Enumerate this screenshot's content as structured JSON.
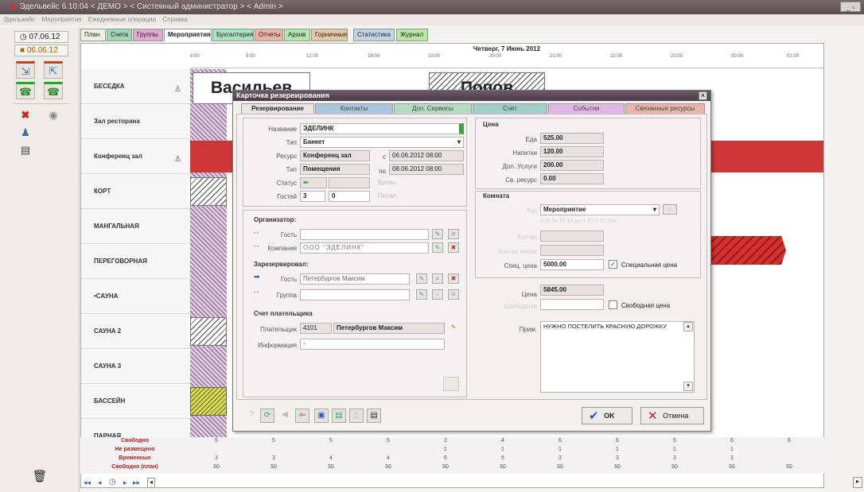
{
  "window": {
    "title": "Эдельвейс 6.10.04 < ДЕМО > < Системный администратор > < Admin >"
  },
  "menu": [
    "Эдельвейс",
    "Мероприятия",
    "Ежедневные операции",
    "Справка"
  ],
  "left": {
    "date1": "07.06.12",
    "date2": "06.06.12"
  },
  "tabs": [
    {
      "label": "План",
      "color": "#f1efe8"
    },
    {
      "label": "Счета",
      "color": "#9fd6b6"
    },
    {
      "label": "Группы",
      "color": "#e4a8d2"
    },
    {
      "label": "Мероприятия",
      "color": "#ffffff"
    },
    {
      "label": "Бухгалтерия",
      "color": "#a9e2c5"
    },
    {
      "label": "Отчеты",
      "color": "#f0b2a6"
    },
    {
      "label": "Архив",
      "color": "#b4e6b0"
    },
    {
      "label": "Горничные",
      "color": "#e6c6a4"
    },
    {
      "label": "Статистика",
      "color": "#c4d4e8"
    },
    {
      "label": "Журнал",
      "color": "#bde6a4"
    }
  ],
  "schedule": {
    "date_title": "Четверг, 7 Июнь 2012",
    "times": [
      "8:00",
      "9:00",
      "12:00",
      "18:00",
      "19:00",
      "20:00",
      "21:00",
      "22:00",
      "23:00",
      "00:00",
      "01:00"
    ],
    "rows": [
      "БЕСЕДКА",
      "Зал ресторана",
      "Конференц зал",
      "КОРТ",
      "МАНГАЛЬНАЯ",
      "ПЕРЕГОВОРНАЯ",
      "•САУНА",
      "САУНА 2",
      "САУНА 3",
      "БАССЕЙН",
      "ПАРНАЯ"
    ],
    "event_vasiliev": "Васильев",
    "event_popov": "Попов"
  },
  "summary": {
    "labels": [
      "Свободно",
      "Не размещено",
      "Временные",
      "Свободно (план)"
    ],
    "rows": [
      [
        "5",
        "5",
        "5",
        "5",
        "2",
        "4",
        "6",
        "6",
        "5",
        "6",
        "6"
      ],
      [
        "",
        "",
        "",
        "",
        "1",
        "1",
        "1",
        "1",
        "1",
        "1",
        ""
      ],
      [
        "3",
        "3",
        "4",
        "4",
        "6",
        "5",
        "3",
        "3",
        "3",
        "3",
        ""
      ],
      [
        "50",
        "50",
        "50",
        "50",
        "50",
        "50",
        "50",
        "50",
        "50",
        "50",
        "50"
      ]
    ]
  },
  "dialog": {
    "title": "Карточка резервирования",
    "tabs": [
      {
        "label": "Резервирование",
        "color": "#e9e6e6"
      },
      {
        "label": "Контакты",
        "color": "#a9c6dc"
      },
      {
        "label": "Доп. Сервисы",
        "color": "#b6dac4"
      },
      {
        "label": "Счет",
        "color": "#9fcfc7"
      },
      {
        "label": "События",
        "color": "#e3b7e3"
      },
      {
        "label": "Связанные ресурсы",
        "color": "#e8b7a9"
      }
    ],
    "name_label": "Название",
    "name_value": "ЭДЕЛИНК",
    "type_label": "Тип",
    "type_value": "Банкет",
    "resource_label": "Ресурс",
    "resource_value": "Конференц зал",
    "from_label": "с",
    "from_value": "06.06.2012 08:00",
    "kind_label": "Тип",
    "kind_value": "Помещения",
    "to_label": "по",
    "to_value": "08.06.2012 08:00",
    "status_label": "Статус",
    "status_btn1": "Бронь",
    "guests_label": "Гостей",
    "guests_value": "3",
    "guests_value2": "0",
    "status_btn2": "Посел.",
    "organizer_title": "Организатор:",
    "org_guest_label": "Гость",
    "org_company_label": "Компания",
    "org_company_value": "ООО \"ЭДЕЛИНК\"",
    "reserved_title": "Зарезервировал:",
    "res_guest_label": "Гость",
    "res_guest_value": "Петербургов Максим",
    "res_group_label": "Группа",
    "payer_title": "Счет плательщика",
    "payer_label": "Плательщик",
    "payer_id": "4101",
    "payer_name": "Петербургов Максим",
    "info_label": "Информация",
    "info_value": "-",
    "price_title": "Цена",
    "food_label": "Еда",
    "food_value": "525.00",
    "drinks_label": "Напитки",
    "drinks_value": "120.00",
    "services_label": "Доп. Услуги",
    "services_value": "200.00",
    "resource_price_label": "Св. ресурс",
    "resource_price_value": "0.00",
    "room_title": "Комната",
    "room_type_label": "Тип",
    "room_type_value": "Мероприятие",
    "room_schedule": "з 10  5к 10  10 дн  э 30 о 10  Тип",
    "count_label": "Кол-во",
    "hourly_label": "Кол-во часов",
    "special_label": "Спец. цена",
    "special_value": "5000.00",
    "special_check": "Специальная цена",
    "total_label": "Цена",
    "total_value": "5845.00",
    "free_label": "Свободная",
    "free_check": "Свободная цена",
    "note_label": "Прим.",
    "note_value": "НУЖНО ПОСТЕЛИТЬ КРАСНУЮ ДОРОЖКУ",
    "ok_label": "OK",
    "cancel_label": "Отмена"
  },
  "colors": {
    "accent": "#d23c3c",
    "ok": "#2b59b8",
    "cancel": "#c42020"
  }
}
